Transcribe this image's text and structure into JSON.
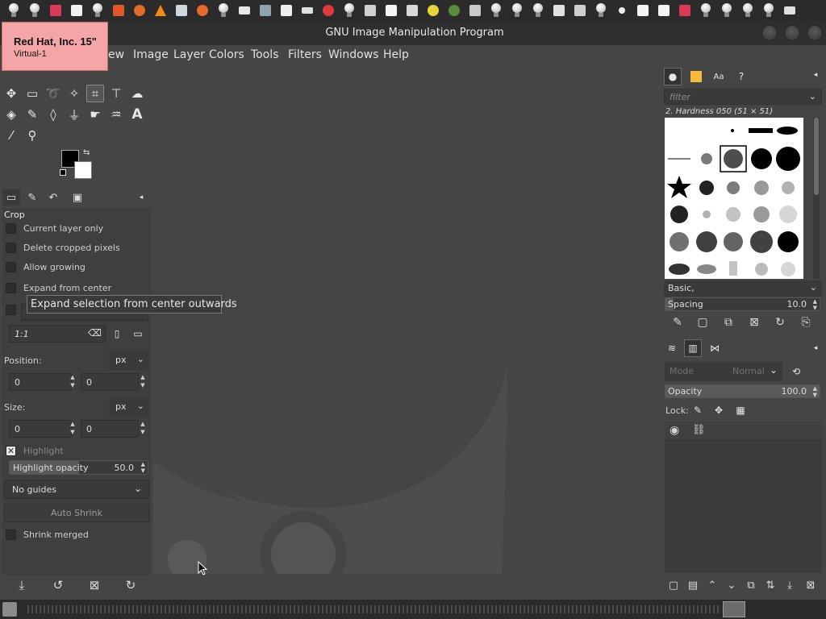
{
  "window": {
    "title": "GNU Image Manipulation Program"
  },
  "vm_popup": {
    "name": "Red Hat, Inc. 15\"",
    "sub": "Virtual-1",
    "bg_color": "#f4a6a6"
  },
  "menubar": {
    "items": [
      "ew",
      "Image",
      "Layer",
      "Colors",
      "Tools",
      "Filters",
      "Windows",
      "Help"
    ]
  },
  "tool_options": {
    "title": "Crop",
    "current_layer_only": "Current layer only",
    "delete_cropped": "Delete cropped pixels",
    "allow_growing": "Allow growing",
    "expand_center": "Expand from center",
    "tooltip": "Expand selection from center outwards",
    "ratio_value": "1:1",
    "position_label": "Position:",
    "position_unit": "px",
    "position_x": "0",
    "position_y": "0",
    "size_label": "Size:",
    "size_unit": "px",
    "size_w": "0",
    "size_h": "0",
    "highlight_label": "Highlight",
    "highlight_opacity_label": "Highlight opacity",
    "highlight_opacity_value": "50.0",
    "guides": "No guides",
    "auto_shrink": "Auto Shrink",
    "shrink_merged": "Shrink merged"
  },
  "brushes": {
    "filter_placeholder": "filter",
    "brush_name": "2. Hardness 050 (51 × 51)",
    "tag": "Basic,",
    "spacing_label": "Spacing",
    "spacing_value": "10.0"
  },
  "layers": {
    "mode_label": "Mode",
    "mode_value": "Normal",
    "opacity_label": "Opacity",
    "opacity_value": "100.0",
    "lock_label": "Lock:"
  },
  "colors": {
    "foreground": "#000000",
    "background": "#ffffff",
    "ui_bg": "#454545"
  }
}
